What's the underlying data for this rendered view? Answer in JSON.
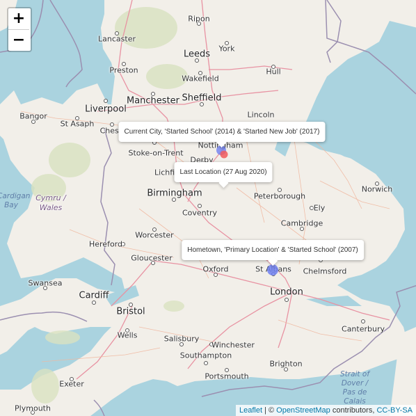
{
  "map": {
    "zoom_in_label": "+",
    "zoom_out_label": "−",
    "attribution": {
      "leaflet": "Leaflet",
      "sep": " | © ",
      "osm": "OpenStreetMap",
      "contributors": " contributors, ",
      "license": "CC-BY-SA"
    },
    "colors": {
      "sea": "#aad3df",
      "land": "#f2efe9",
      "blue_marker": "#6f7ff0",
      "red_marker": "#f25a5a"
    },
    "popups": [
      {
        "id": "current-city",
        "text": "Current City, 'Started School' (2014) & 'Started New Job' (2017)"
      },
      {
        "id": "last-location",
        "text": "Last Location (27 Aug 2020)"
      },
      {
        "id": "hometown",
        "text": "Hometown, 'Primary Location' & 'Started School' (2007)"
      }
    ],
    "markers": [
      {
        "name": "current-city-marker",
        "color": "blue"
      },
      {
        "name": "last-location-marker",
        "color": "red"
      },
      {
        "name": "hometown-marker",
        "color": "blue"
      }
    ],
    "places": {
      "lancaster": "Lancaster",
      "preston": "Preston",
      "ripon": "Ripon",
      "york": "York",
      "leeds": "Leeds",
      "wakefield": "Wakefield",
      "hull": "Hull",
      "manchester": "Manchester",
      "sheffield": "Sheffield",
      "liverpool": "Liverpool",
      "bangor": "Bangor",
      "st_asaph": "St Asaph",
      "chester": "Chester",
      "lincoln": "Lincoln",
      "nottingham": "Nottingham",
      "stoke": "Stoke-on-Trent",
      "derby": "Derby",
      "lichfield": "Lichfield",
      "norwich": "Norwich",
      "peterborough": "Peterborough",
      "ely": "Ely",
      "birmingham": "Birmingham",
      "coventry": "Coventry",
      "cambridge": "Cambridge",
      "hereford": "Hereford",
      "worcester": "Worcester",
      "gloucester": "Gloucester",
      "oxford": "Oxford",
      "st_albans": "St Albans",
      "chelmsford": "Chelmsford",
      "swansea": "Swansea",
      "cardiff": "Cardiff",
      "london": "London",
      "bristol": "Bristol",
      "canterbury": "Canterbury",
      "wells": "Wells",
      "salisbury": "Salisbury",
      "winchester": "Winchester",
      "southampton": "Southampton",
      "brighton": "Brighton",
      "portsmouth": "Portsmouth",
      "exeter": "Exeter",
      "plymouth": "Plymouth",
      "cardigan_bay": "Cardigan Bay",
      "wales": "Cymru / Wales",
      "strait": "Strait of Dover / Pas de Calais"
    }
  }
}
